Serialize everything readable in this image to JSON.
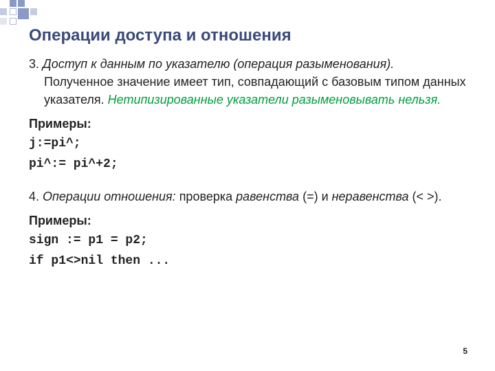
{
  "slide": {
    "title": "Операции доступа и отношения",
    "block3": {
      "lead": "3. ",
      "italic1": "Доступ к данным  по указателю (операция разыменования). ",
      "normal": "Полученное  значение имеет тип, совпадающий с базовым типом данных указателя. ",
      "warn": "Нетипизированные указатели разыменовывать нельзя."
    },
    "examples_label": "Примеры:",
    "ex1": {
      "l1": "j:=pi^;",
      "l2": "pi^:= pi^+2;"
    },
    "block4": {
      "lead": "4. ",
      "italic": "Операции отношения: ",
      "normal1": "проверка ",
      "italic2": "равенства",
      "normal2": " (=) и ",
      "italic3": "неравенства",
      "normal3": " (< >)."
    },
    "ex2": {
      "l1": "sign := p1 = p2;",
      "l2": "if p1<>nil then ..."
    },
    "pagenum": "5"
  }
}
